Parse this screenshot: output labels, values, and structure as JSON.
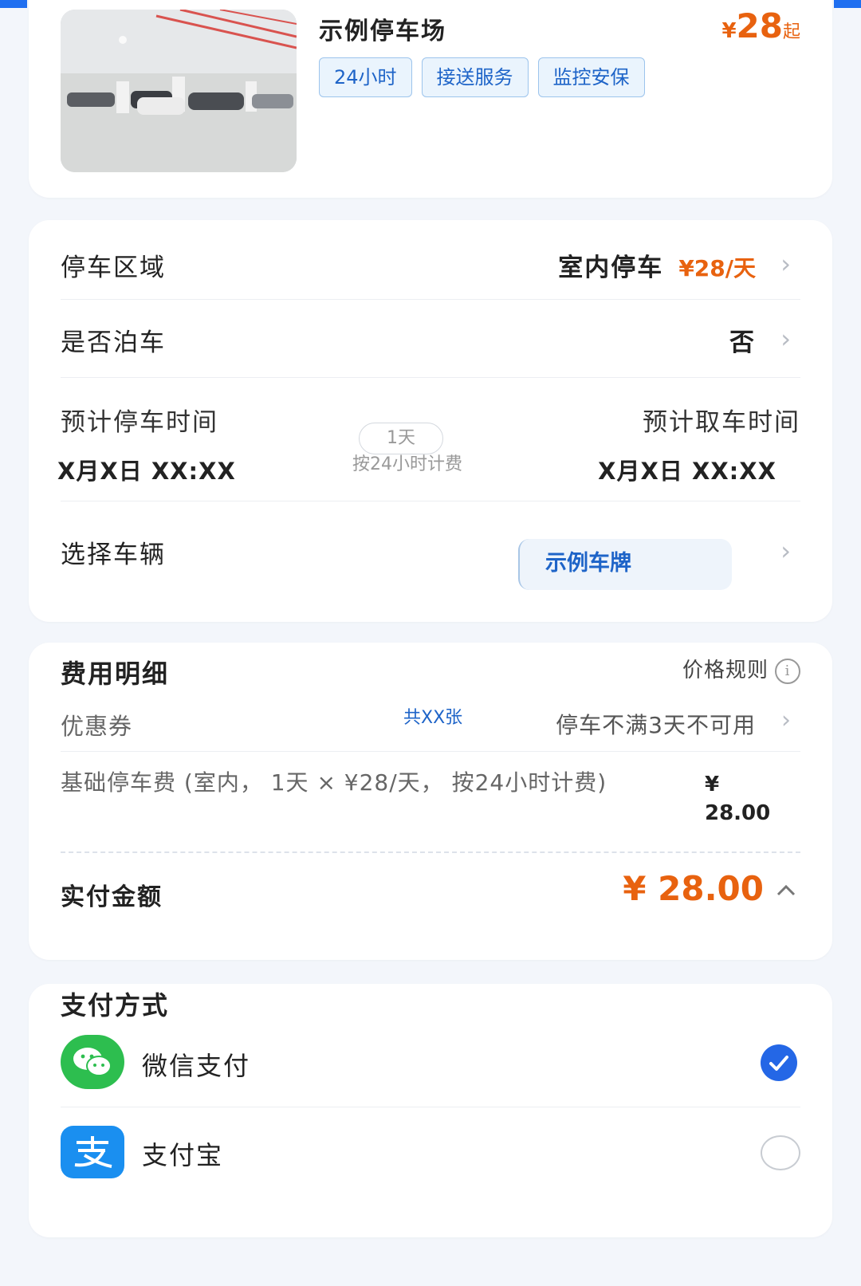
{
  "lot": {
    "name": "示例停车场",
    "price_symbol": "¥",
    "price_value": "28",
    "price_suffix": "起",
    "tags": [
      "24小时",
      "接送服务",
      "监控安保"
    ]
  },
  "booking": {
    "area_label": "停车区域",
    "area_value": "室内停车",
    "area_price": "¥28/天",
    "valet_label": "是否泊车",
    "valet_value": "否",
    "park_time_label": "预计停车时间",
    "park_time_value": "X月X日 XX:XX",
    "duration": "1天",
    "billing_note": "按24小时计费",
    "pickup_time_label": "预计取车时间",
    "pickup_time_value": "X月X日 XX:XX",
    "vehicle_label": "选择车辆",
    "vehicle_value": "示例车牌"
  },
  "fees": {
    "title": "费用明细",
    "price_rules": "价格规则",
    "coupon_label": "优惠券",
    "coupon_count": "共XX张",
    "coupon_status": "停车不满3天不可用",
    "base_fee_desc": "基础停车费 (室内， 1天 × ¥28/天， 按24小时计费)",
    "base_fee_symbol": "¥",
    "base_fee_amount": "28.00",
    "total_label": "实付金额",
    "total_amount": "¥ 28.00"
  },
  "payment": {
    "title": "支付方式",
    "methods": [
      {
        "name": "微信支付",
        "icon": "wechat-pay-icon",
        "selected": true
      },
      {
        "name": "支付宝",
        "icon": "alipay-icon",
        "selected": false
      }
    ]
  },
  "colors": {
    "accent": "#e8620f",
    "blue": "#1e64c8",
    "wechat": "#2dbe4f",
    "alipay": "#1a8ff0",
    "check": "#2467e6"
  }
}
